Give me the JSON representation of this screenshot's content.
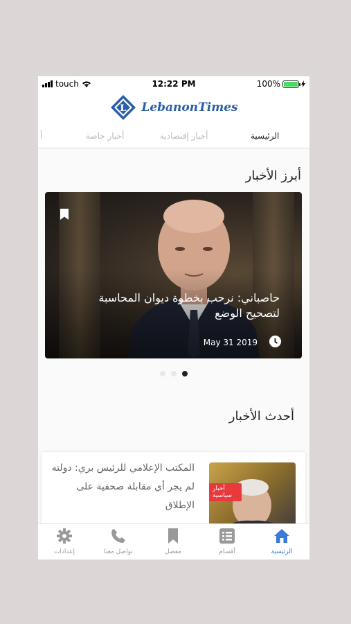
{
  "status_bar": {
    "carrier": "touch",
    "time": "12:22 PM",
    "battery": "100%",
    "battery_level": 1.0
  },
  "logo": {
    "text": "LebanonTimes"
  },
  "tabs": [
    "الرئيسية",
    "أخبار إقتصادية",
    "أخبار خاصة",
    "أ"
  ],
  "sections": {
    "featured": "أبرز الأخبار",
    "latest": "أحدث الأخبار"
  },
  "featured": {
    "headline": "حاصباني: نرحب بخطوة ديوان المحاسبة لتصحيح الوضع",
    "date": "May 31 2019",
    "slide_count": 3,
    "active_slide": 3
  },
  "latest_card": {
    "text": "المكتب الإعلامي للرئيس بري: دولته لم يجر أي مقابلة صحفية على الإطلاق",
    "badge": "أخبار سياسية"
  },
  "bottom_nav": [
    "الرئيسية",
    "أقسام",
    "مفضل",
    "تواصل معنا",
    "إعدادات"
  ],
  "colors": {
    "accent": "#3a7bd5",
    "badge": "#e8393c",
    "logo": "#2a5ea8",
    "battery": "#4cd964"
  },
  "icons": {
    "nav": [
      "home-icon",
      "list-icon",
      "bookmark-icon",
      "phone-icon",
      "gear-icon"
    ]
  }
}
